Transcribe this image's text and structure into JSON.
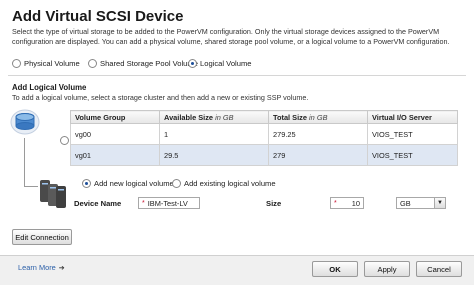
{
  "dialog": {
    "title": "Add Virtual SCSI Device",
    "description": "Select the type of virtual storage to be added to the PowerVM configuration. Only the virtual storage devices assigned to the PowerVM configuration are displayed. You can add a physical volume, shared storage pool volume, or a logical volume to a PowerVM configuration."
  },
  "storage_type": {
    "options": [
      "Physical Volume",
      "Shared Storage Pool Volume",
      "Logical Volume"
    ],
    "selected": "Logical Volume"
  },
  "section": {
    "title": "Add Logical Volume",
    "description": "To add a logical volume, select a storage cluster and then add a new or existing SSP volume."
  },
  "table": {
    "headers": [
      "Volume Group",
      "Available Size",
      "Total Size",
      "Virtual I/O Server"
    ],
    "unit": "in GB",
    "rows": [
      {
        "volume_group": "vg00",
        "available": "1",
        "total": "279.25",
        "vios": "VIOS_TEST",
        "selected": false
      },
      {
        "volume_group": "vg01",
        "available": "29.5",
        "total": "279",
        "vios": "VIOS_TEST",
        "selected": true
      }
    ]
  },
  "lv_mode": {
    "options": [
      "Add new logical volume",
      "Add existing logical volume"
    ],
    "selected": "Add new logical volume"
  },
  "device": {
    "name_label": "Device Name",
    "name_value": "IBM-Test-LV",
    "size_label": "Size",
    "size_value": "10",
    "unit_value": "GB"
  },
  "buttons": {
    "edit_connection": "Edit Connection",
    "ok": "OK",
    "apply": "Apply",
    "cancel": "Cancel"
  },
  "footer": {
    "learn_more": "Learn More"
  },
  "icons": {
    "storage": "storage-cluster-icon",
    "disk_stack": "disk-stack-icon",
    "learn_more_arrow": "arrow-right-icon",
    "dropdown": "chevron-down-icon"
  },
  "colors": {
    "selected_row": "#dfe7f3",
    "required_marker": "#c8102e",
    "link": "#2b5fa8"
  }
}
